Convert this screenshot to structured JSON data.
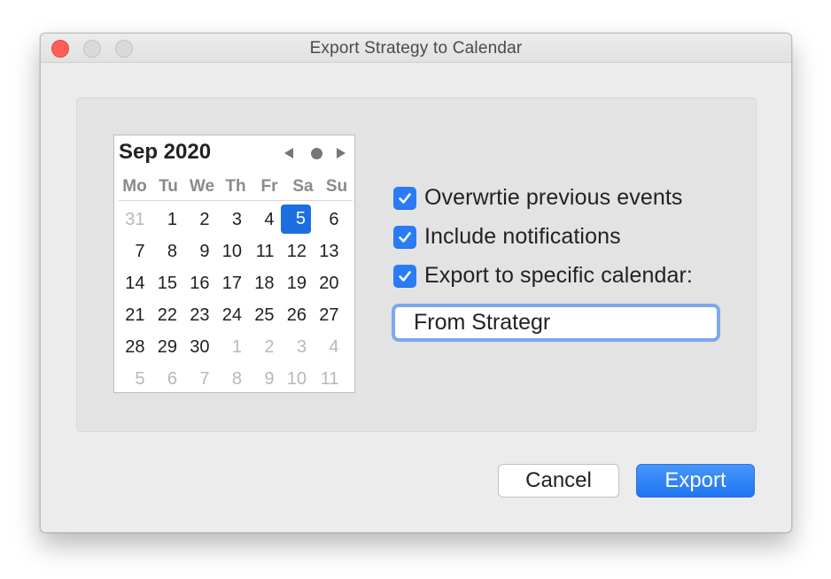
{
  "window": {
    "title": "Export Strategy to Calendar"
  },
  "calendar": {
    "month_label": "Sep 2020",
    "weekdays": [
      "Mo",
      "Tu",
      "We",
      "Th",
      "Fr",
      "Sa",
      "Su"
    ],
    "days": [
      {
        "label": "31",
        "muted": true
      },
      {
        "label": "1"
      },
      {
        "label": "2"
      },
      {
        "label": "3"
      },
      {
        "label": "4"
      },
      {
        "label": "5",
        "selected": true
      },
      {
        "label": "6"
      },
      {
        "label": "7"
      },
      {
        "label": "8"
      },
      {
        "label": "9"
      },
      {
        "label": "10"
      },
      {
        "label": "11"
      },
      {
        "label": "12"
      },
      {
        "label": "13"
      },
      {
        "label": "14"
      },
      {
        "label": "15"
      },
      {
        "label": "16"
      },
      {
        "label": "17"
      },
      {
        "label": "18"
      },
      {
        "label": "19"
      },
      {
        "label": "20"
      },
      {
        "label": "21"
      },
      {
        "label": "22"
      },
      {
        "label": "23"
      },
      {
        "label": "24"
      },
      {
        "label": "25"
      },
      {
        "label": "26"
      },
      {
        "label": "27"
      },
      {
        "label": "28"
      },
      {
        "label": "29"
      },
      {
        "label": "30"
      },
      {
        "label": "1",
        "muted": true
      },
      {
        "label": "2",
        "muted": true
      },
      {
        "label": "3",
        "muted": true
      },
      {
        "label": "4",
        "muted": true
      },
      {
        "label": "5",
        "muted": true
      },
      {
        "label": "6",
        "muted": true
      },
      {
        "label": "7",
        "muted": true
      },
      {
        "label": "8",
        "muted": true
      },
      {
        "label": "9",
        "muted": true
      },
      {
        "label": "10",
        "muted": true
      },
      {
        "label": "11",
        "muted": true
      }
    ]
  },
  "options": {
    "overwrite_label": "Overwrtie previous events",
    "overwrite_checked": true,
    "notifications_label": "Include notifications",
    "notifications_checked": true,
    "specific_calendar_label": "Export to specific calendar:",
    "specific_calendar_checked": true,
    "calendar_name_value": "From Strategr"
  },
  "buttons": {
    "cancel": "Cancel",
    "export": "Export"
  },
  "colors": {
    "accent": "#1f75f0",
    "selected_day": "#1d6fe0",
    "close_button": "#ff5f57"
  }
}
